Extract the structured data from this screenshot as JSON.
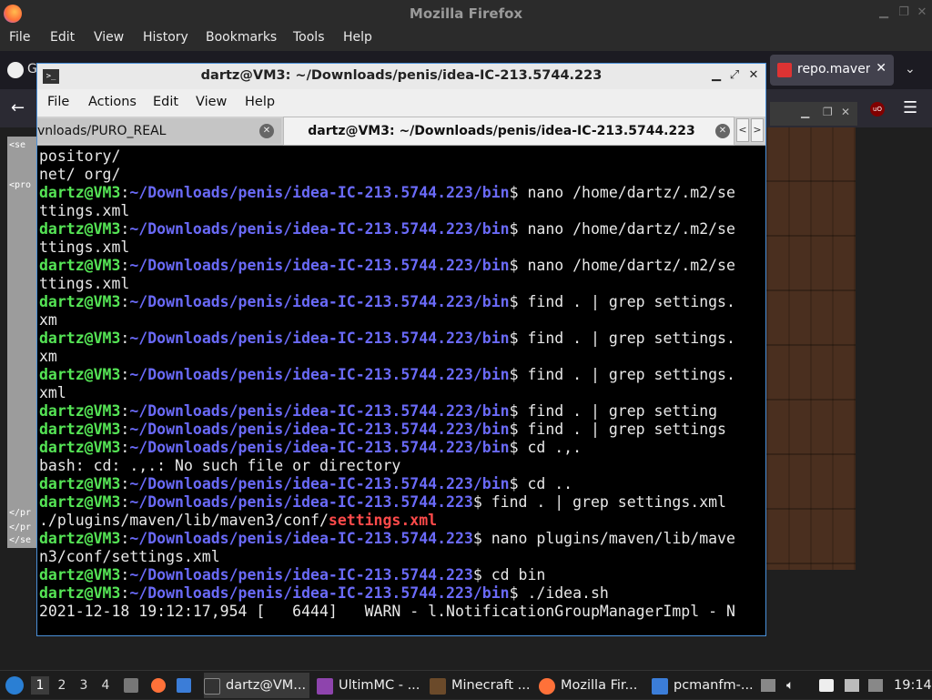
{
  "firefox": {
    "title": "Mozilla Firefox",
    "menu": [
      "File",
      "Edit",
      "View",
      "History",
      "Bookmarks",
      "Tools",
      "Help"
    ],
    "tab_github_partial": "G",
    "tab_maven": "repo.maven",
    "left_code_lines": [
      "<se",
      "<pro",
      "</pr",
      "</pr",
      "</se"
    ]
  },
  "terminal": {
    "title": "dartz@VM3: ~/Downloads/penis/idea-IC-213.5744.223",
    "menu": [
      "File",
      "Actions",
      "Edit",
      "View",
      "Help"
    ],
    "tabs": [
      {
        "label": "vnloads/PURO_REAL"
      },
      {
        "label": "dartz@VM3: ~/Downloads/penis/idea-IC-213.5744.223"
      }
    ],
    "lines": [
      [
        {
          "t": "pository/",
          "c": ""
        }
      ],
      [
        {
          "t": "net/ org/",
          "c": ""
        }
      ],
      [
        {
          "t": "dartz@VM3",
          "c": "u"
        },
        {
          "t": ":",
          "c": ""
        },
        {
          "t": "~/Downloads/penis/idea-IC-213.5744.223/bin",
          "c": "p"
        },
        {
          "t": "$ nano /home/dartz/.m2/se",
          "c": ""
        }
      ],
      [
        {
          "t": "ttings.xml",
          "c": ""
        }
      ],
      [
        {
          "t": "dartz@VM3",
          "c": "u"
        },
        {
          "t": ":",
          "c": ""
        },
        {
          "t": "~/Downloads/penis/idea-IC-213.5744.223/bin",
          "c": "p"
        },
        {
          "t": "$ nano /home/dartz/.m2/se",
          "c": ""
        }
      ],
      [
        {
          "t": "ttings.xml",
          "c": ""
        }
      ],
      [
        {
          "t": "dartz@VM3",
          "c": "u"
        },
        {
          "t": ":",
          "c": ""
        },
        {
          "t": "~/Downloads/penis/idea-IC-213.5744.223/bin",
          "c": "p"
        },
        {
          "t": "$ nano /home/dartz/.m2/se",
          "c": ""
        }
      ],
      [
        {
          "t": "ttings.xml",
          "c": ""
        }
      ],
      [
        {
          "t": "dartz@VM3",
          "c": "u"
        },
        {
          "t": ":",
          "c": ""
        },
        {
          "t": "~/Downloads/penis/idea-IC-213.5744.223/bin",
          "c": "p"
        },
        {
          "t": "$ find . | grep settings.",
          "c": ""
        }
      ],
      [
        {
          "t": "xm",
          "c": ""
        }
      ],
      [
        {
          "t": "dartz@VM3",
          "c": "u"
        },
        {
          "t": ":",
          "c": ""
        },
        {
          "t": "~/Downloads/penis/idea-IC-213.5744.223/bin",
          "c": "p"
        },
        {
          "t": "$ find . | grep settings.",
          "c": ""
        }
      ],
      [
        {
          "t": "xm",
          "c": ""
        }
      ],
      [
        {
          "t": "dartz@VM3",
          "c": "u"
        },
        {
          "t": ":",
          "c": ""
        },
        {
          "t": "~/Downloads/penis/idea-IC-213.5744.223/bin",
          "c": "p"
        },
        {
          "t": "$ find . | grep settings.",
          "c": ""
        }
      ],
      [
        {
          "t": "xml",
          "c": ""
        }
      ],
      [
        {
          "t": "dartz@VM3",
          "c": "u"
        },
        {
          "t": ":",
          "c": ""
        },
        {
          "t": "~/Downloads/penis/idea-IC-213.5744.223/bin",
          "c": "p"
        },
        {
          "t": "$ find . | grep setting",
          "c": ""
        }
      ],
      [
        {
          "t": "dartz@VM3",
          "c": "u"
        },
        {
          "t": ":",
          "c": ""
        },
        {
          "t": "~/Downloads/penis/idea-IC-213.5744.223/bin",
          "c": "p"
        },
        {
          "t": "$ find . | grep settings",
          "c": ""
        }
      ],
      [
        {
          "t": "dartz@VM3",
          "c": "u"
        },
        {
          "t": ":",
          "c": ""
        },
        {
          "t": "~/Downloads/penis/idea-IC-213.5744.223/bin",
          "c": "p"
        },
        {
          "t": "$ cd .,.",
          "c": ""
        }
      ],
      [
        {
          "t": "bash: cd: .,.: No such file or directory",
          "c": ""
        }
      ],
      [
        {
          "t": "dartz@VM3",
          "c": "u"
        },
        {
          "t": ":",
          "c": ""
        },
        {
          "t": "~/Downloads/penis/idea-IC-213.5744.223/bin",
          "c": "p"
        },
        {
          "t": "$ cd ..",
          "c": ""
        }
      ],
      [
        {
          "t": "dartz@VM3",
          "c": "u"
        },
        {
          "t": ":",
          "c": ""
        },
        {
          "t": "~/Downloads/penis/idea-IC-213.5744.223",
          "c": "p"
        },
        {
          "t": "$ find . | grep settings.xml",
          "c": ""
        }
      ],
      [
        {
          "t": "./plugins/maven/lib/maven3/conf/",
          "c": ""
        },
        {
          "t": "settings.xml",
          "c": "r"
        }
      ],
      [
        {
          "t": "dartz@VM3",
          "c": "u"
        },
        {
          "t": ":",
          "c": ""
        },
        {
          "t": "~/Downloads/penis/idea-IC-213.5744.223",
          "c": "p"
        },
        {
          "t": "$ nano plugins/maven/lib/mave",
          "c": ""
        }
      ],
      [
        {
          "t": "n3/conf/settings.xml",
          "c": ""
        }
      ],
      [
        {
          "t": "dartz@VM3",
          "c": "u"
        },
        {
          "t": ":",
          "c": ""
        },
        {
          "t": "~/Downloads/penis/idea-IC-213.5744.223",
          "c": "p"
        },
        {
          "t": "$ cd bin",
          "c": ""
        }
      ],
      [
        {
          "t": "dartz@VM3",
          "c": "u"
        },
        {
          "t": ":",
          "c": ""
        },
        {
          "t": "~/Downloads/penis/idea-IC-213.5744.223/bin",
          "c": "p"
        },
        {
          "t": "$ ./idea.sh",
          "c": ""
        }
      ],
      [
        {
          "t": "2021-12-18 19:12:17,954 [   6444]   WARN - l.NotificationGroupManagerImpl - N",
          "c": ""
        }
      ]
    ]
  },
  "taskbar": {
    "desktops": [
      "1",
      "2",
      "3",
      "4"
    ],
    "tasks": [
      {
        "label": "dartz@VM...",
        "icon": "terminal-icon",
        "color": "#333333"
      },
      {
        "label": "UltimMC - ...",
        "icon": "ultimmc-icon",
        "color": "#8e44ad"
      },
      {
        "label": "Minecraft ...",
        "icon": "minecraft-icon",
        "color": "#6b4a2a"
      },
      {
        "label": "Mozilla Fir...",
        "icon": "firefox-icon",
        "color": "#ff7139"
      },
      {
        "label": "pcmanfm-...",
        "icon": "folder-icon",
        "color": "#3b7dd8"
      }
    ],
    "clock": "19:14"
  }
}
